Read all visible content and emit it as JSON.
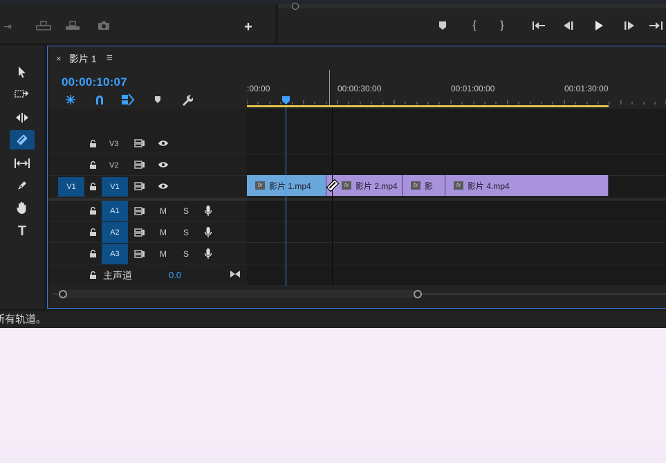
{
  "timeline": {
    "sequence_name": "影片 1",
    "close_glyph": "×",
    "menu_glyph": "≡",
    "timecode": "00:00:10:07",
    "ruler_labels": [
      ":00:00",
      "00:00:30:00",
      "00:01:00:00",
      "00:01:30:00"
    ],
    "video_tracks": [
      {
        "label": "V3"
      },
      {
        "label": "V2"
      },
      {
        "label": "V1",
        "source": "V1"
      }
    ],
    "audio_tracks": [
      {
        "label": "A1",
        "m": "M",
        "s": "S"
      },
      {
        "label": "A2",
        "m": "M",
        "s": "S"
      },
      {
        "label": "A3",
        "m": "M",
        "s": "S"
      }
    ],
    "master": {
      "label": "主声道",
      "value": "0.0"
    },
    "clips": [
      {
        "name": "影片 1.mp4",
        "color": "#6aa7dc"
      },
      {
        "name": "影片 2.mp4",
        "color": "#a892dc"
      },
      {
        "name": "影",
        "color": "#a892dc"
      },
      {
        "name": "影片 4.mp4",
        "color": "#a892dc"
      }
    ]
  },
  "status_bar": {
    "text": "所有轨道。"
  },
  "colors": {
    "accent": "#3aa0ff",
    "work_area": "#e3c14a",
    "clip_blue": "#6aa7dc",
    "clip_purple": "#a892dc"
  }
}
